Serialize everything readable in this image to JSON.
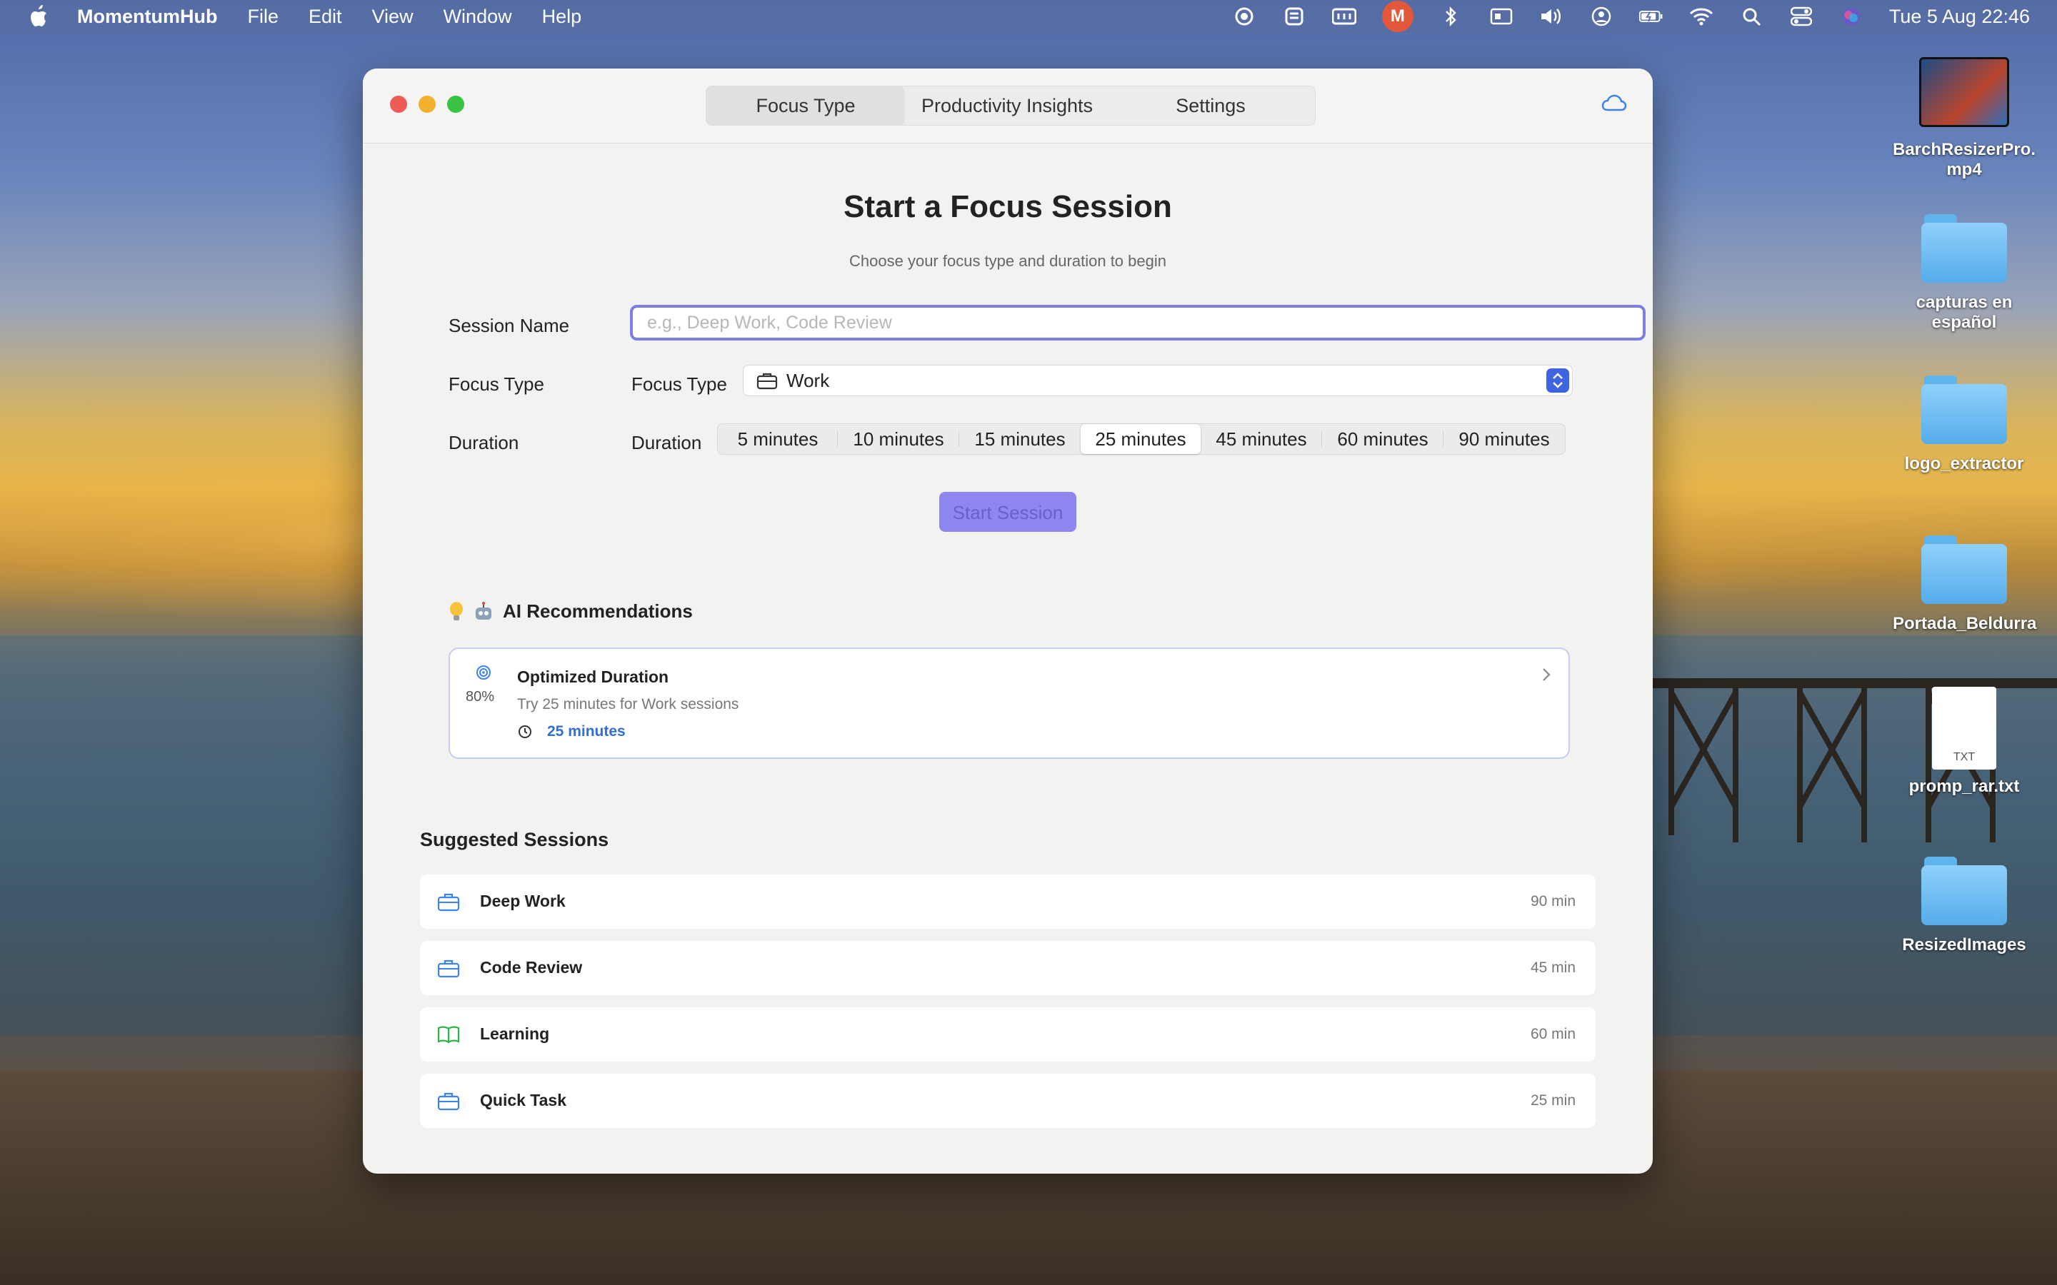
{
  "menubar": {
    "app_name": "MomentumHub",
    "menus": [
      "File",
      "Edit",
      "View",
      "Window",
      "Help"
    ],
    "tray_badge_label": "M",
    "clock": "Tue 5 Aug  22:46",
    "tray_icons": [
      "screen-record-icon",
      "menu-extra-icon",
      "keyboard-icon",
      "momentum-app-icon",
      "bluetooth-icon",
      "display-icon",
      "volume-icon",
      "user-icon",
      "battery-icon",
      "wifi-icon",
      "spotlight-icon",
      "control-center-icon",
      "siri-icon"
    ]
  },
  "desktop": {
    "items": [
      {
        "label": "BarchResizerPro.\nmp4",
        "kind": "video"
      },
      {
        "label": "capturas en\nespañol",
        "kind": "folder"
      },
      {
        "label": "logo_extractor",
        "kind": "folder"
      },
      {
        "label": "Portada_Beldurra",
        "kind": "folder"
      },
      {
        "label": "promp_rar.txt",
        "kind": "txt",
        "doc_tag": "TXT"
      },
      {
        "label": "ResizedImages",
        "kind": "folder"
      }
    ]
  },
  "window": {
    "tabs": [
      "Focus Type",
      "Productivity Insights",
      "Settings"
    ],
    "active_tab": "Focus Type",
    "title": "Start a Focus Session",
    "subtitle": "Choose your focus type and duration to begin",
    "session_name": {
      "label": "Session Name",
      "placeholder": "e.g., Deep Work, Code Review",
      "value": ""
    },
    "focus_type": {
      "label": "Focus Type",
      "inline_label": "Focus Type",
      "selected": "Work"
    },
    "duration": {
      "label": "Duration",
      "inline_label": "Duration",
      "options": [
        "5 minutes",
        "10 minutes",
        "15 minutes",
        "25 minutes",
        "45 minutes",
        "60 minutes",
        "90 minutes"
      ],
      "selected": "25 minutes"
    },
    "start_button": "Start Session",
    "ai": {
      "heading": "AI Recommendations",
      "card": {
        "confidence": "80%",
        "title": "Optimized Duration",
        "description": "Try 25 minutes for Work sessions",
        "duration": "25 minutes"
      }
    },
    "suggested": {
      "heading": "Suggested Sessions",
      "items": [
        {
          "name": "Deep Work",
          "minutes": "90 min",
          "icon": "briefcase-icon",
          "color": "#3b82f6"
        },
        {
          "name": "Code Review",
          "minutes": "45 min",
          "icon": "briefcase-icon",
          "color": "#3b82f6"
        },
        {
          "name": "Learning",
          "minutes": "60 min",
          "icon": "book-icon",
          "color": "#2fb34a"
        },
        {
          "name": "Quick Task",
          "minutes": "25 min",
          "icon": "briefcase-icon",
          "color": "#3b82f6"
        }
      ]
    }
  },
  "colors": {
    "accent": "#7b7fe6",
    "start_button": "#8f87f0",
    "link_blue": "#2f6fd8",
    "stepper_blue": "#3f64e0"
  }
}
